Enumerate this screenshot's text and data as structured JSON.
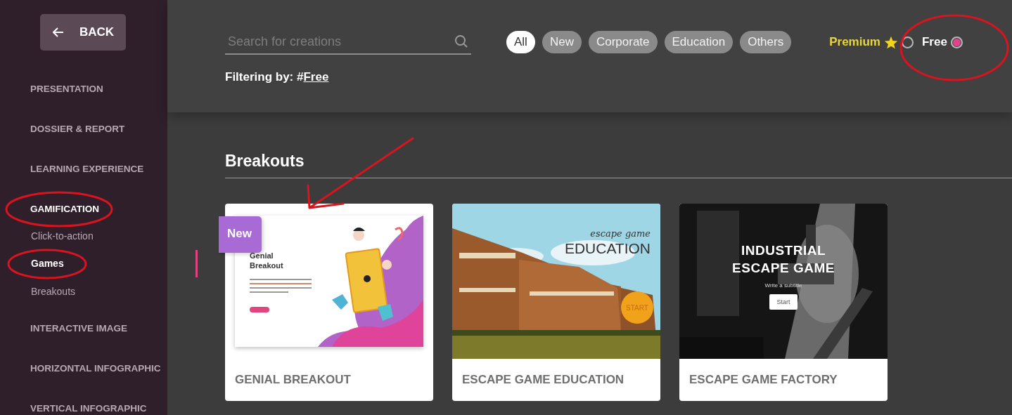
{
  "sidebar": {
    "back_button": {
      "label": "BACK"
    },
    "items": [
      {
        "label": "PRESENTATION",
        "selected": false,
        "circled": false
      },
      {
        "label": "DOSSIER & REPORT",
        "selected": false,
        "circled": false
      },
      {
        "label": "LEARNING EXPERIENCE",
        "selected": false,
        "circled": false
      },
      {
        "label": "GAMIFICATION",
        "selected": true,
        "circled": true,
        "children": [
          {
            "label": "Click-to-action",
            "selected": false,
            "circled": false
          },
          {
            "label": "Games",
            "selected": true,
            "circled": true
          },
          {
            "label": "Breakouts",
            "selected": false,
            "circled": false
          }
        ]
      },
      {
        "label": "INTERACTIVE IMAGE",
        "selected": false,
        "circled": false
      },
      {
        "label": "HORIZONTAL INFOGRAPHIC",
        "selected": false,
        "circled": false
      },
      {
        "label": "VERTICAL INFOGRAPHIC",
        "selected": false,
        "circled": false
      }
    ]
  },
  "search": {
    "placeholder": "Search for creations"
  },
  "categories": [
    {
      "label": "All",
      "selected": true
    },
    {
      "label": "New",
      "selected": false
    },
    {
      "label": "Corporate",
      "selected": false
    },
    {
      "label": "Education",
      "selected": false
    },
    {
      "label": "Others",
      "selected": false
    }
  ],
  "plan_filters": [
    {
      "label": "Premium",
      "kind": "premium",
      "selected": false,
      "circled": false
    },
    {
      "label": "Free",
      "kind": "free",
      "selected": true,
      "circled": true
    }
  ],
  "filter_note": {
    "prefix": "Filtering by: #",
    "tag": "Free"
  },
  "section": {
    "title": "Breakouts",
    "cards": [
      {
        "title": "GENIAL BREAKOUT",
        "badge": "New",
        "arrowed": true,
        "preview": {
          "kind": "illustration",
          "heading": "Genial Breakout"
        }
      },
      {
        "title": "ESCAPE GAME EDUCATION",
        "arrowed": false,
        "preview": {
          "kind": "school",
          "overline": "escape game",
          "heading": "EDUCATION",
          "button": "START"
        }
      },
      {
        "title": "ESCAPE GAME FACTORY",
        "arrowed": false,
        "preview": {
          "kind": "factory",
          "heading": "INDUSTRIAL ESCAPE GAME",
          "subtitle": "Write a subtitle",
          "button": "Start"
        }
      }
    ]
  }
}
